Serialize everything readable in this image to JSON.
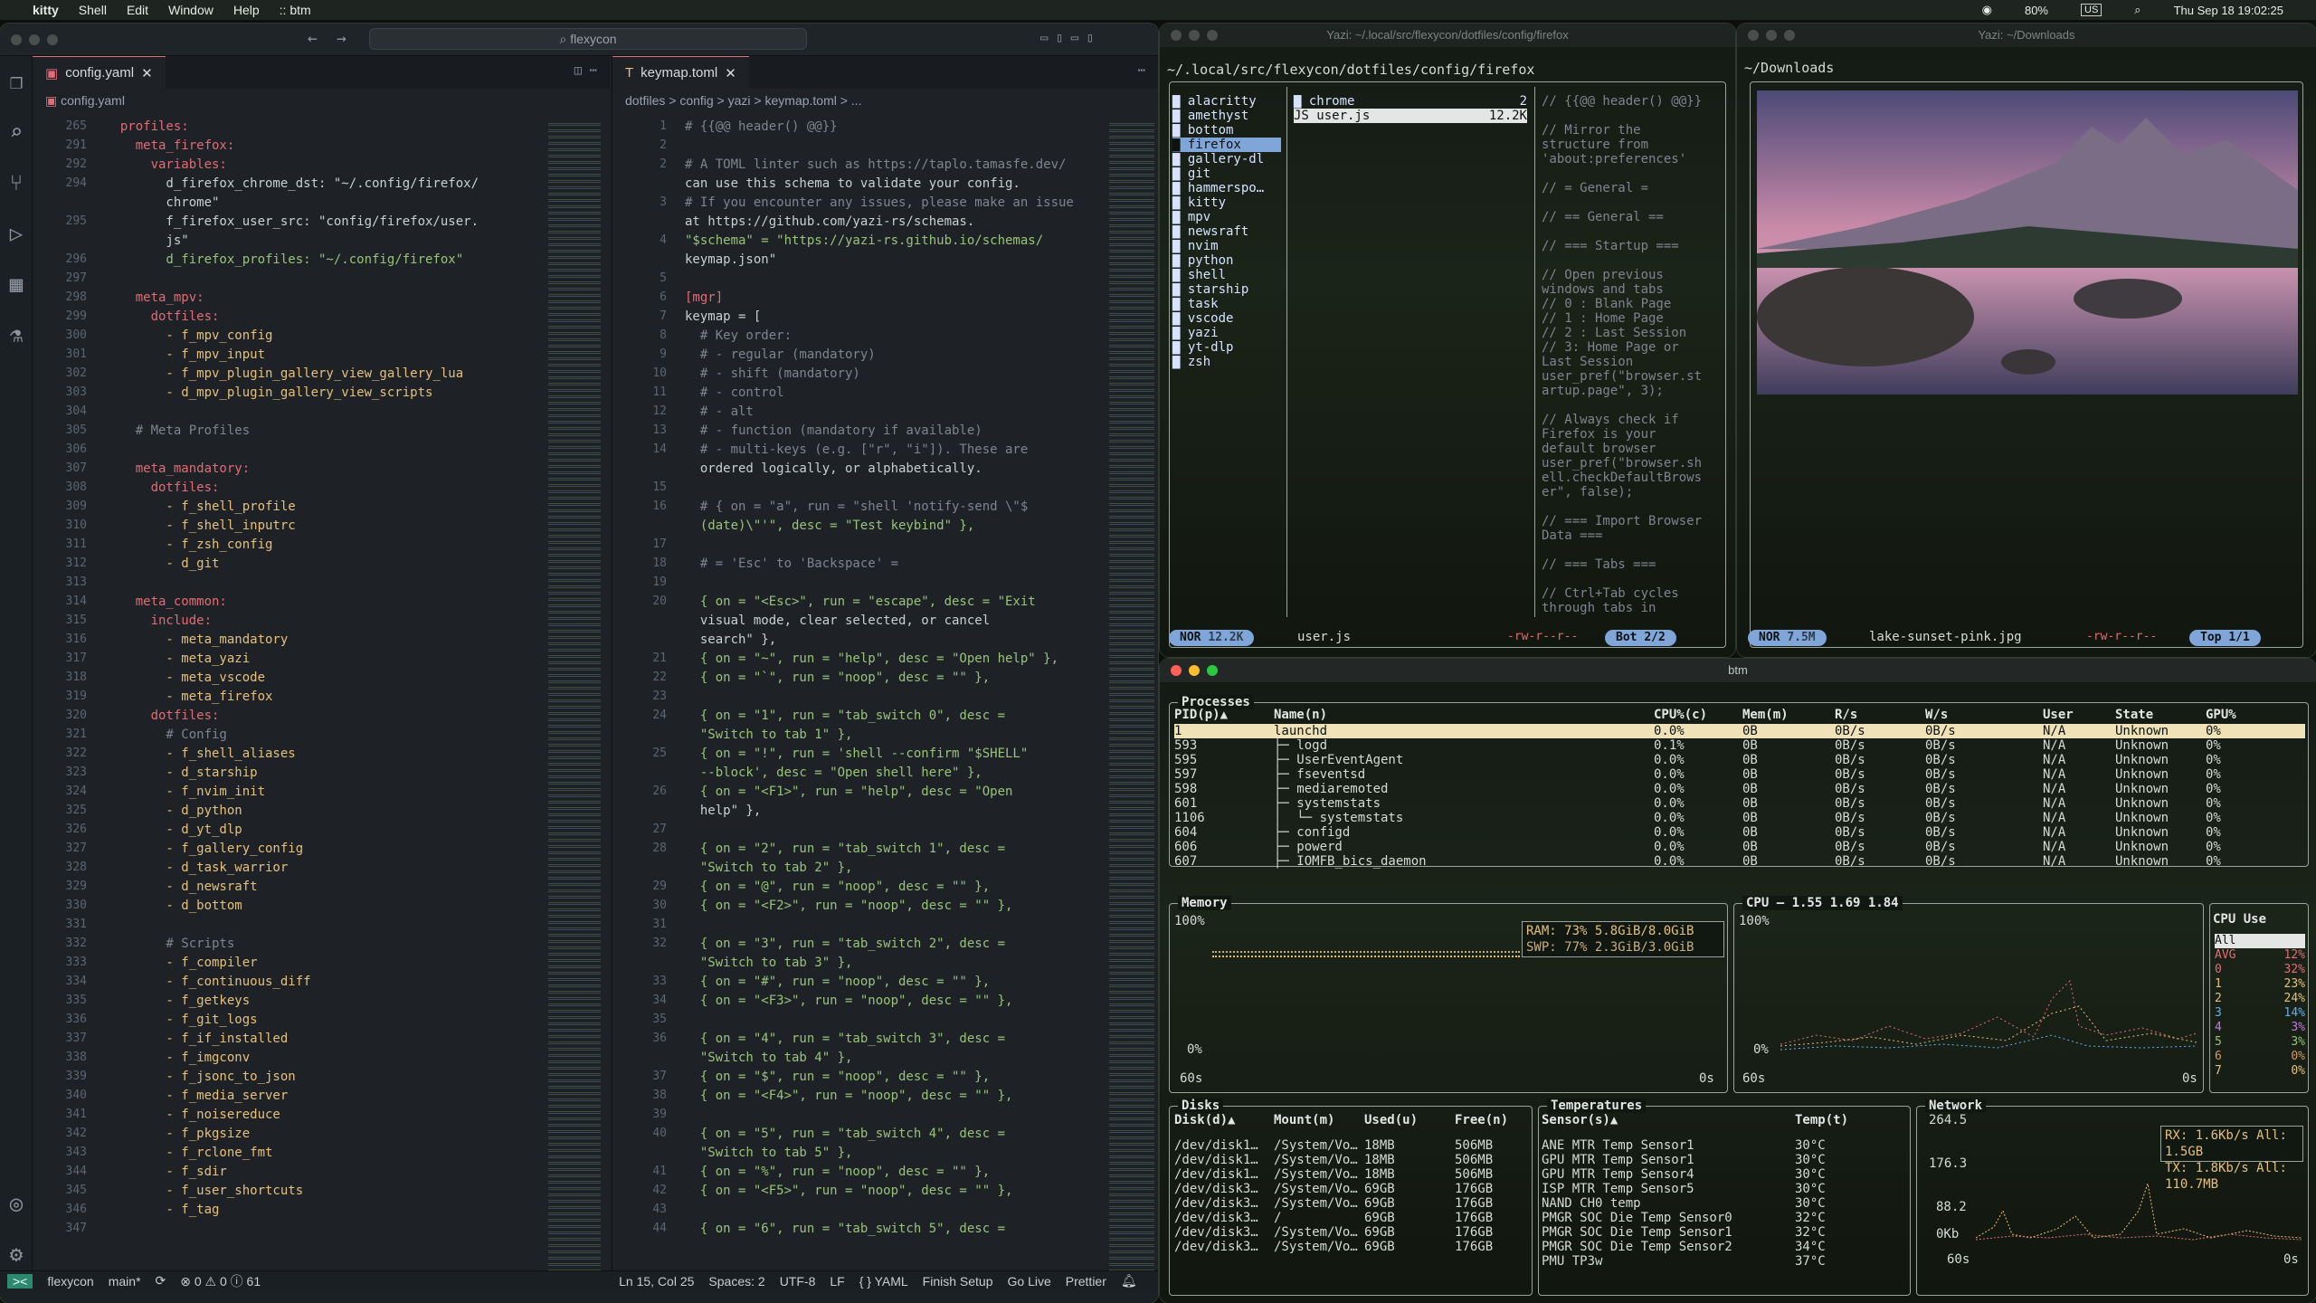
{
  "menubar": {
    "apple": "",
    "app": "kitty",
    "items": [
      "Shell",
      "Edit",
      "Window",
      "Help"
    ],
    "title_suffix": ":: btm",
    "battery": "80%",
    "input": "US",
    "datetime": "Thu Sep 18  19:02:25"
  },
  "vscode": {
    "search_placeholder": "flexycon",
    "left_tab": "config.yaml",
    "right_tab": "keymap.toml",
    "left_crumb": "config.yaml",
    "right_crumb": "dotfiles  >  config  >  yazi  >  keymap.toml  >  ...",
    "left_lines": [
      [
        "265",
        "  profiles:"
      ],
      [
        "291",
        "    meta_firefox:"
      ],
      [
        "292",
        "      variables:"
      ],
      [
        "294",
        "        d_firefox_chrome_dst: \"~/.config/firefox/"
      ],
      [
        "",
        "        chrome\""
      ],
      [
        "295",
        "        f_firefox_user_src: \"config/firefox/user."
      ],
      [
        "",
        "        js\""
      ],
      [
        "296",
        "        d_firefox_profiles: \"~/.config/firefox\""
      ],
      [
        "297",
        ""
      ],
      [
        "298",
        "    meta_mpv:"
      ],
      [
        "299",
        "      dotfiles:"
      ],
      [
        "300",
        "        - f_mpv_config"
      ],
      [
        "301",
        "        - f_mpv_input"
      ],
      [
        "302",
        "        - f_mpv_plugin_gallery_view_gallery_lua"
      ],
      [
        "303",
        "        - d_mpv_plugin_gallery_view_scripts"
      ],
      [
        "304",
        ""
      ],
      [
        "305",
        "    # Meta Profiles"
      ],
      [
        "306",
        ""
      ],
      [
        "307",
        "    meta_mandatory:"
      ],
      [
        "308",
        "      dotfiles:"
      ],
      [
        "309",
        "        - f_shell_profile"
      ],
      [
        "310",
        "        - f_shell_inputrc"
      ],
      [
        "311",
        "        - f_zsh_config"
      ],
      [
        "312",
        "        - d_git"
      ],
      [
        "313",
        ""
      ],
      [
        "314",
        "    meta_common:"
      ],
      [
        "315",
        "      include:"
      ],
      [
        "316",
        "        - meta_mandatory"
      ],
      [
        "317",
        "        - meta_yazi"
      ],
      [
        "318",
        "        - meta_vscode"
      ],
      [
        "319",
        "        - meta_firefox"
      ],
      [
        "320",
        "      dotfiles:"
      ],
      [
        "321",
        "        # Config"
      ],
      [
        "322",
        "        - f_shell_aliases"
      ],
      [
        "323",
        "        - d_starship"
      ],
      [
        "324",
        "        - f_nvim_init"
      ],
      [
        "325",
        "        - d_python"
      ],
      [
        "326",
        "        - d_yt_dlp"
      ],
      [
        "327",
        "        - f_gallery_config"
      ],
      [
        "328",
        "        - d_task_warrior"
      ],
      [
        "329",
        "        - d_newsraft"
      ],
      [
        "330",
        "        - d_bottom"
      ],
      [
        "331",
        ""
      ],
      [
        "332",
        "        # Scripts"
      ],
      [
        "333",
        "        - f_compiler"
      ],
      [
        "334",
        "        - f_continuous_diff"
      ],
      [
        "335",
        "        - f_getkeys"
      ],
      [
        "336",
        "        - f_git_logs"
      ],
      [
        "337",
        "        - f_if_installed"
      ],
      [
        "338",
        "        - f_imgconv"
      ],
      [
        "339",
        "        - f_jsonc_to_json"
      ],
      [
        "340",
        "        - f_media_server"
      ],
      [
        "341",
        "        - f_noisereduce"
      ],
      [
        "342",
        "        - f_pkgsize"
      ],
      [
        "343",
        "        - f_rclone_fmt"
      ],
      [
        "344",
        "        - f_sdir"
      ],
      [
        "345",
        "        - f_user_shortcuts"
      ],
      [
        "346",
        "        - f_tag"
      ],
      [
        "347",
        ""
      ]
    ],
    "right_lines": [
      [
        "1",
        "# {{@@ header() @@}}"
      ],
      [
        "2",
        ""
      ],
      [
        "2",
        "# A TOML linter such as https://taplo.tamasfe.dev/"
      ],
      [
        "",
        "can use this schema to validate your config."
      ],
      [
        "3",
        "# If you encounter any issues, please make an issue"
      ],
      [
        "",
        "at https://github.com/yazi-rs/schemas."
      ],
      [
        "4",
        "\"$schema\" = \"https://yazi-rs.github.io/schemas/"
      ],
      [
        "",
        "keymap.json\""
      ],
      [
        "5",
        ""
      ],
      [
        "6",
        "[mgr]"
      ],
      [
        "7",
        "keymap = ["
      ],
      [
        "8",
        "  # Key order:"
      ],
      [
        "9",
        "  # - regular (mandatory)"
      ],
      [
        "10",
        "  # - shift (mandatory)"
      ],
      [
        "11",
        "  # - control"
      ],
      [
        "12",
        "  # - alt"
      ],
      [
        "13",
        "  # - function (mandatory if available)"
      ],
      [
        "14",
        "  # - multi-keys (e.g. [\"r\", \"i\"]). These are"
      ],
      [
        "",
        "  ordered logically, or alphabetically."
      ],
      [
        "15",
        ""
      ],
      [
        "16",
        "  # { on = \"a\", run = \"shell 'notify-send \\\"$"
      ],
      [
        "",
        "  (date)\\\"'\", desc = \"Test keybind\" },"
      ],
      [
        "17",
        ""
      ],
      [
        "18",
        "  # = 'Esc' to 'Backspace' ="
      ],
      [
        "19",
        ""
      ],
      [
        "20",
        "  { on = \"<Esc>\", run = \"escape\", desc = \"Exit"
      ],
      [
        "",
        "  visual mode, clear selected, or cancel"
      ],
      [
        "",
        "  search\" },"
      ],
      [
        "21",
        "  { on = \"~\", run = \"help\", desc = \"Open help\" },"
      ],
      [
        "22",
        "  { on = \"`\", run = \"noop\", desc = \"\" },"
      ],
      [
        "23",
        ""
      ],
      [
        "24",
        "  { on = \"1\", run = \"tab_switch 0\", desc ="
      ],
      [
        "",
        "  \"Switch to tab 1\" },"
      ],
      [
        "25",
        "  { on = \"!\", run = 'shell --confirm \"$SHELL\""
      ],
      [
        "",
        "  --block', desc = \"Open shell here\" },"
      ],
      [
        "26",
        "  { on = \"<F1>\", run = \"help\", desc = \"Open"
      ],
      [
        "",
        "  help\" },"
      ],
      [
        "27",
        ""
      ],
      [
        "28",
        "  { on = \"2\", run = \"tab_switch 1\", desc ="
      ],
      [
        "",
        "  \"Switch to tab 2\" },"
      ],
      [
        "29",
        "  { on = \"@\", run = \"noop\", desc = \"\" },"
      ],
      [
        "30",
        "  { on = \"<F2>\", run = \"noop\", desc = \"\" },"
      ],
      [
        "31",
        ""
      ],
      [
        "32",
        "  { on = \"3\", run = \"tab_switch 2\", desc ="
      ],
      [
        "",
        "  \"Switch to tab 3\" },"
      ],
      [
        "33",
        "  { on = \"#\", run = \"noop\", desc = \"\" },"
      ],
      [
        "34",
        "  { on = \"<F3>\", run = \"noop\", desc = \"\" },"
      ],
      [
        "35",
        ""
      ],
      [
        "36",
        "  { on = \"4\", run = \"tab_switch 3\", desc ="
      ],
      [
        "",
        "  \"Switch to tab 4\" },"
      ],
      [
        "37",
        "  { on = \"$\", run = \"noop\", desc = \"\" },"
      ],
      [
        "38",
        "  { on = \"<F4>\", run = \"noop\", desc = \"\" },"
      ],
      [
        "39",
        ""
      ],
      [
        "40",
        "  { on = \"5\", run = \"tab_switch 4\", desc ="
      ],
      [
        "",
        "  \"Switch to tab 5\" },"
      ],
      [
        "41",
        "  { on = \"%\", run = \"noop\", desc = \"\" },"
      ],
      [
        "42",
        "  { on = \"<F5>\", run = \"noop\", desc = \"\" },"
      ],
      [
        "43",
        ""
      ],
      [
        "44",
        "  { on = \"6\", run = \"tab_switch 5\", desc ="
      ]
    ],
    "status": {
      "remote": "><",
      "project": "flexycon",
      "branch": "main*",
      "problems": "⊗ 0 ⚠ 0 ⓘ 61",
      "position": "Ln 15, Col 25",
      "spaces": "Spaces: 2",
      "encoding": "UTF-8",
      "eol": "LF",
      "language": "{ } YAML",
      "setup": "Finish Setup",
      "golive": "Go Live",
      "prettier": "Prettier"
    }
  },
  "yazi_left": {
    "title": "Yazi: ~/.local/src/flexycon/dotfiles/config/firefox",
    "path": "~/.local/src/flexycon/dotfiles/config/firefox",
    "parents": [
      "alacritty",
      "amethyst",
      "bottom",
      "firefox",
      "gallery-dl",
      "git",
      "hammerspo…",
      "kitty",
      "mpv",
      "newsraft",
      "nvim",
      "python",
      "shell",
      "starship",
      "task",
      "vscode",
      "yazi",
      "yt-dlp",
      "zsh"
    ],
    "current": [
      {
        "name": "chrome",
        "size": "2"
      },
      {
        "name": "user.js",
        "size": "12.2K"
      }
    ],
    "preview": [
      "// {{@@ header() @@}}",
      "",
      "// Mirror the",
      "structure from",
      "'about:preferences'",
      "",
      "// = General =",
      "",
      "// == General ==",
      "",
      "// === Startup ===",
      "",
      "// Open previous",
      "windows and tabs",
      "// 0 : Blank Page",
      "// 1 : Home Page",
      "// 2 : Last Session",
      "// 3: Home Page or",
      "Last Session",
      "user_pref(\"browser.st",
      "artup.page\", 3);",
      "",
      "// Always check if",
      "Firefox is your",
      "default browser",
      "user_pref(\"browser.sh",
      "ell.checkDefaultBrows",
      "er\", false);",
      "",
      "// === Import Browser",
      "Data ===",
      "",
      "// === Tabs ===",
      "",
      "// Ctrl+Tab cycles",
      "through tabs in"
    ],
    "mode": "NOR",
    "size": "12.2K",
    "file": "user.js",
    "perms": "-rw-r--r--",
    "pos": "Bot",
    "count": "2/2"
  },
  "yazi_right": {
    "title": "Yazi: ~/Downloads",
    "path": "~/Downloads",
    "mode": "NOR",
    "size": "7.5M",
    "file": "lake-sunset-pink.jpg",
    "perms": "-rw-r--r--",
    "pos": "Top",
    "count": "1/1"
  },
  "btm": {
    "title": "btm",
    "proc_title": "Processes",
    "proc_headers": [
      "PID(p)▲",
      "Name(n)",
      "CPU%(c)",
      "Mem(m)",
      "R/s",
      "W/s",
      "User",
      "State",
      "GPU%"
    ],
    "procs": [
      [
        "1",
        "launchd",
        "0.0%",
        "0B",
        "0B/s",
        "0B/s",
        "N/A",
        "Unknown",
        "0%"
      ],
      [
        "593",
        "├─ logd",
        "0.1%",
        "0B",
        "0B/s",
        "0B/s",
        "N/A",
        "Unknown",
        "0%"
      ],
      [
        "595",
        "├─ UserEventAgent",
        "0.0%",
        "0B",
        "0B/s",
        "0B/s",
        "N/A",
        "Unknown",
        "0%"
      ],
      [
        "597",
        "├─ fseventsd",
        "0.0%",
        "0B",
        "0B/s",
        "0B/s",
        "N/A",
        "Unknown",
        "0%"
      ],
      [
        "598",
        "├─ mediaremoted",
        "0.0%",
        "0B",
        "0B/s",
        "0B/s",
        "N/A",
        "Unknown",
        "0%"
      ],
      [
        "601",
        "├─ systemstats",
        "0.0%",
        "0B",
        "0B/s",
        "0B/s",
        "N/A",
        "Unknown",
        "0%"
      ],
      [
        "1106",
        "│  └─ systemstats",
        "0.0%",
        "0B",
        "0B/s",
        "0B/s",
        "N/A",
        "Unknown",
        "0%"
      ],
      [
        "604",
        "├─ configd",
        "0.0%",
        "0B",
        "0B/s",
        "0B/s",
        "N/A",
        "Unknown",
        "0%"
      ],
      [
        "606",
        "├─ powerd",
        "0.0%",
        "0B",
        "0B/s",
        "0B/s",
        "N/A",
        "Unknown",
        "0%"
      ],
      [
        "607",
        "├─ IOMFB_bics_daemon",
        "0.0%",
        "0B",
        "0B/s",
        "0B/s",
        "N/A",
        "Unknown",
        "0%"
      ]
    ],
    "memory": {
      "title": "Memory",
      "ram": "RAM: 73%    5.8GiB/8.0GiB",
      "swp": "SWP: 77%    2.3GiB/3.0GiB",
      "ymax": "100%",
      "ymin": "0%",
      "xl": "60s",
      "xr": "0s",
      "ram_level": 0.73,
      "swp_level": 0.77
    },
    "cpu": {
      "title": "CPU — 1.55 1.69 1.84",
      "ymax": "100%",
      "ymin": "0%",
      "xl": "60s",
      "xr": "0s"
    },
    "cpu_use": {
      "title": "CPU Use",
      "rows": [
        {
          "k": "All",
          "v": "",
          "c": "#e3e6e4"
        },
        {
          "k": "AVG",
          "v": "12%",
          "c": "#e06c75"
        },
        {
          "k": "0",
          "v": "32%",
          "c": "#e06c75"
        },
        {
          "k": "1",
          "v": "23%",
          "c": "#e5c07b"
        },
        {
          "k": "2",
          "v": "24%",
          "c": "#e5c07b"
        },
        {
          "k": "3",
          "v": "14%",
          "c": "#61afef"
        },
        {
          "k": "4",
          "v": "3%",
          "c": "#c678dd"
        },
        {
          "k": "5",
          "v": "3%",
          "c": "#98c379"
        },
        {
          "k": "6",
          "v": "0%",
          "c": "#d19a66"
        },
        {
          "k": "7",
          "v": "0%",
          "c": "#e5c07b"
        }
      ]
    },
    "disks": {
      "title": "Disks",
      "headers": [
        "Disk(d)▲",
        "Mount(m)",
        "Used(u)",
        "Free(n)"
      ],
      "rows": [
        [
          "/dev/disk1…",
          "/System/Vo…",
          "18MB",
          "506MB"
        ],
        [
          "/dev/disk1…",
          "/System/Vo…",
          "18MB",
          "506MB"
        ],
        [
          "/dev/disk1…",
          "/System/Vo…",
          "18MB",
          "506MB"
        ],
        [
          "/dev/disk3…",
          "/System/Vo…",
          "69GB",
          "176GB"
        ],
        [
          "/dev/disk3…",
          "/System/Vo…",
          "69GB",
          "176GB"
        ],
        [
          "/dev/disk3…",
          "/",
          "69GB",
          "176GB"
        ],
        [
          "/dev/disk3…",
          "/System/Vo…",
          "69GB",
          "176GB"
        ],
        [
          "/dev/disk3…",
          "/System/Vo…",
          "69GB",
          "176GB"
        ]
      ]
    },
    "temps": {
      "title": "Temperatures",
      "headers": [
        "Sensor(s)▲",
        "Temp(t)"
      ],
      "rows": [
        [
          "ANE MTR Temp Sensor1",
          "30°C"
        ],
        [
          "GPU MTR Temp Sensor1",
          "30°C"
        ],
        [
          "GPU MTR Temp Sensor4",
          "30°C"
        ],
        [
          "ISP MTR Temp Sensor5",
          "30°C"
        ],
        [
          "NAND CH0 temp",
          "30°C"
        ],
        [
          "PMGR SOC Die Temp Sensor0",
          "32°C"
        ],
        [
          "PMGR SOC Die Temp Sensor1",
          "32°C"
        ],
        [
          "PMGR SOC Die Temp Sensor2",
          "34°C"
        ],
        [
          "PMU TP3w",
          "37°C"
        ]
      ]
    },
    "network": {
      "title": "Network",
      "y": [
        "264.5",
        "176.3",
        "88.2",
        "0Kb"
      ],
      "rx": "RX: 1.6Kb/s",
      "tx": "TX: 1.8Kb/s",
      "all_rx": "All: 1.5GB",
      "all_tx": "All: 110.7MB",
      "xl": "60s",
      "xr": "0s"
    }
  },
  "colors": {
    "accent": "#7fa5d9",
    "keyword": "#e5c07b",
    "string": "#98c379",
    "comment": "#7f848e"
  }
}
